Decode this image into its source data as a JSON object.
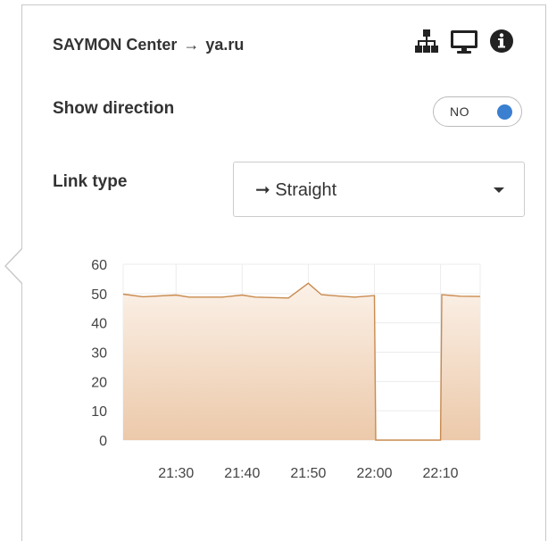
{
  "header": {
    "source": "SAYMON Center",
    "arrow": "→",
    "target": "ya.ru",
    "icons": [
      "sitemap-icon",
      "monitor-icon",
      "info-circle-icon"
    ]
  },
  "direction": {
    "label": "Show direction",
    "toggle_text": "NO",
    "toggle_color": "#3a7fd0"
  },
  "link_type": {
    "label": "Link type",
    "selected": "➞ Straight"
  },
  "chart_data": {
    "type": "area",
    "x_ticks": [
      "21:30",
      "21:40",
      "21:50",
      "22:00",
      "22:10"
    ],
    "y_ticks": [
      "0",
      "10",
      "20",
      "30",
      "40",
      "50",
      "60"
    ],
    "ylim": [
      0,
      60
    ],
    "x_domain": [
      "21:22",
      "22:16"
    ],
    "series": [
      {
        "color": "#c98a4e",
        "points": [
          [
            "21:22",
            49.8
          ],
          [
            "21:25",
            48.9
          ],
          [
            "21:30",
            49.5
          ],
          [
            "21:32",
            48.8
          ],
          [
            "21:37",
            48.8
          ],
          [
            "21:40",
            49.5
          ],
          [
            "21:42",
            48.8
          ],
          [
            "21:47",
            48.5
          ],
          [
            "21:50",
            53.5
          ],
          [
            "21:52",
            49.6
          ],
          [
            "21:55",
            49.1
          ],
          [
            "21:57",
            48.8
          ],
          [
            "22:00",
            49.3
          ],
          [
            "22:00.2",
            0
          ],
          [
            "22:10",
            0
          ],
          [
            "22:10.2",
            49.6
          ],
          [
            "22:13",
            49.1
          ],
          [
            "22:16",
            49.0
          ]
        ]
      }
    ]
  }
}
